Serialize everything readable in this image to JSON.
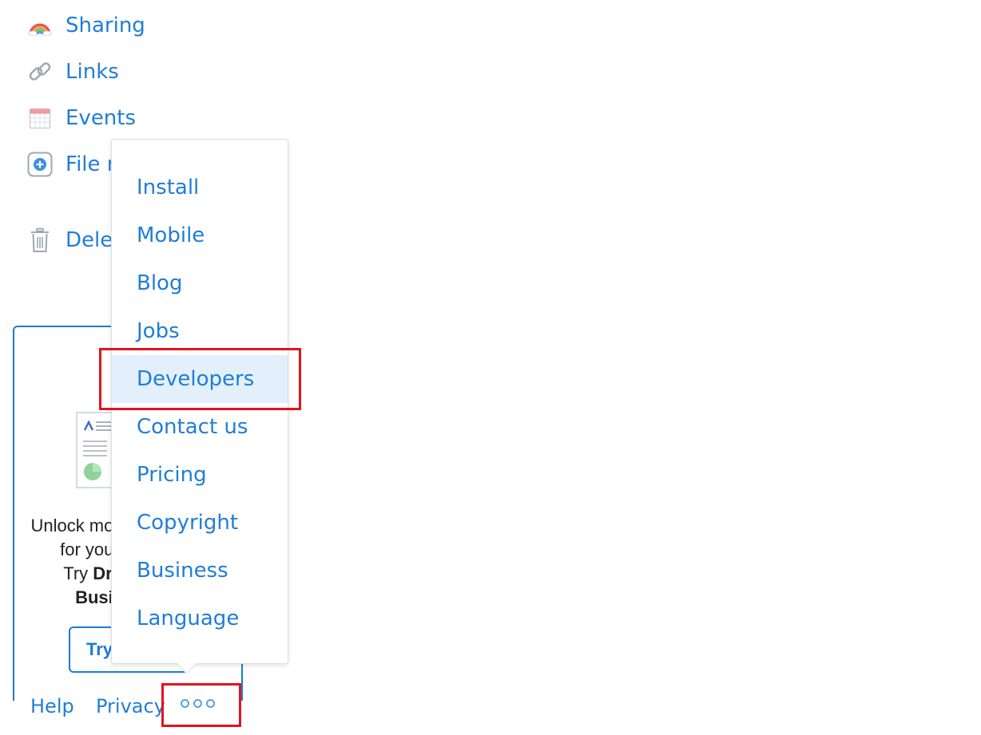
{
  "sidebar": {
    "items": [
      {
        "label": "Sharing",
        "icon": "rainbow-icon"
      },
      {
        "label": "Links",
        "icon": "chain-link-icon"
      },
      {
        "label": "Events",
        "icon": "calendar-icon"
      },
      {
        "label": "File requests",
        "icon": "add-circle-icon"
      },
      {
        "label": "Deleted files",
        "icon": "trash-icon"
      }
    ]
  },
  "promo": {
    "line1": "Unlock more features",
    "line2": "for your team.",
    "line3_prefix": "Try ",
    "line3_bold": "Dropbox",
    "line4_bold": "Business",
    "button_label": "Try free"
  },
  "menu": {
    "items": [
      {
        "label": "Install"
      },
      {
        "label": "Mobile"
      },
      {
        "label": "Blog"
      },
      {
        "label": "Jobs"
      },
      {
        "label": "Developers",
        "active": true
      },
      {
        "label": "Contact us"
      },
      {
        "label": "Pricing"
      },
      {
        "label": "Copyright"
      },
      {
        "label": "Business"
      },
      {
        "label": "Language"
      }
    ]
  },
  "footer": {
    "help": "Help",
    "privacy": "Privacy",
    "more_icon": "more-dots-icon"
  },
  "colors": {
    "link": "#1f7ed8",
    "highlight": "#e0141e",
    "active_bg": "#e3f0fb"
  }
}
